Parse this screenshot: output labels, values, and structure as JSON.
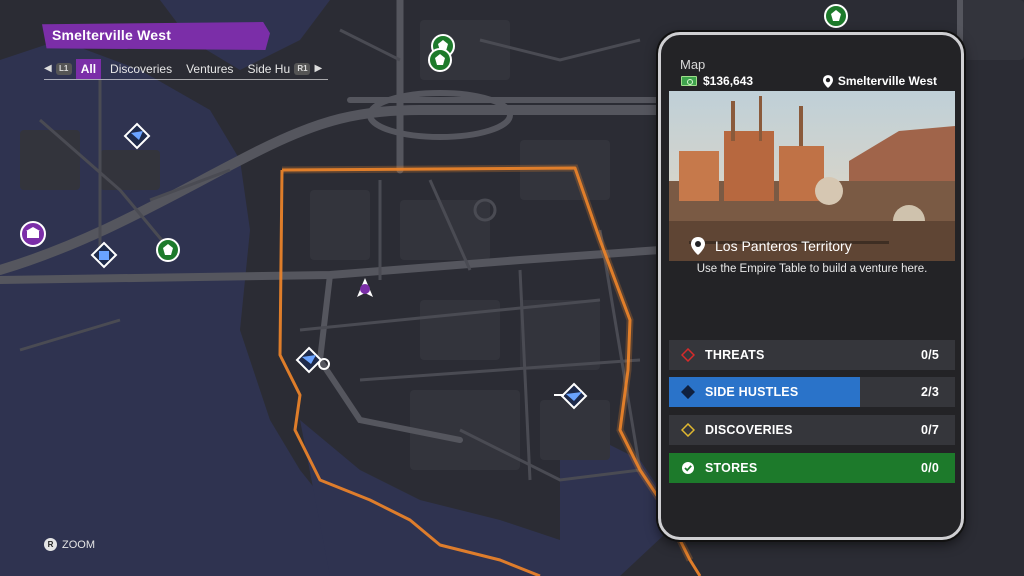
{
  "district": "Smelterville West",
  "filters": {
    "left_button": "L1",
    "right_button": "R1",
    "tabs": [
      {
        "label": "All",
        "active": true
      },
      {
        "label": "Discoveries",
        "active": false
      },
      {
        "label": "Ventures",
        "active": false
      },
      {
        "label": "Side Hustles",
        "active": false
      }
    ]
  },
  "zoom_hint": {
    "button": "R",
    "label": "ZOOM"
  },
  "panel": {
    "title": "Map",
    "money": "$136,643",
    "location": "Smelterville West",
    "territory": "Los Panteros Territory",
    "description": "Use the Empire Table to build a venture here.",
    "rows": [
      {
        "label": "THREATS",
        "count": "0/5",
        "progress": 0,
        "color": "#d62b2b"
      },
      {
        "label": "SIDE HUSTLES",
        "count": "2/3",
        "progress": 0.667,
        "color": "#2a73c9"
      },
      {
        "label": "DISCOVERIES",
        "count": "0/7",
        "progress": 0,
        "color": "#e0b830"
      },
      {
        "label": "STORES",
        "count": "0/0",
        "progress": 1,
        "color": "#1d7a2b"
      }
    ]
  },
  "map_icons": [
    {
      "name": "store-icon",
      "kind": "store"
    },
    {
      "name": "side-hustle-icon",
      "kind": "hustle"
    },
    {
      "name": "discovery-icon",
      "kind": "venture"
    },
    {
      "name": "player-marker-icon",
      "kind": "player"
    }
  ],
  "colors": {
    "accent_purple": "#7b2ea8",
    "territory_orange": "#e8822a",
    "water": "#2f3350",
    "land": "#2b2c34",
    "road": "#55565e"
  }
}
